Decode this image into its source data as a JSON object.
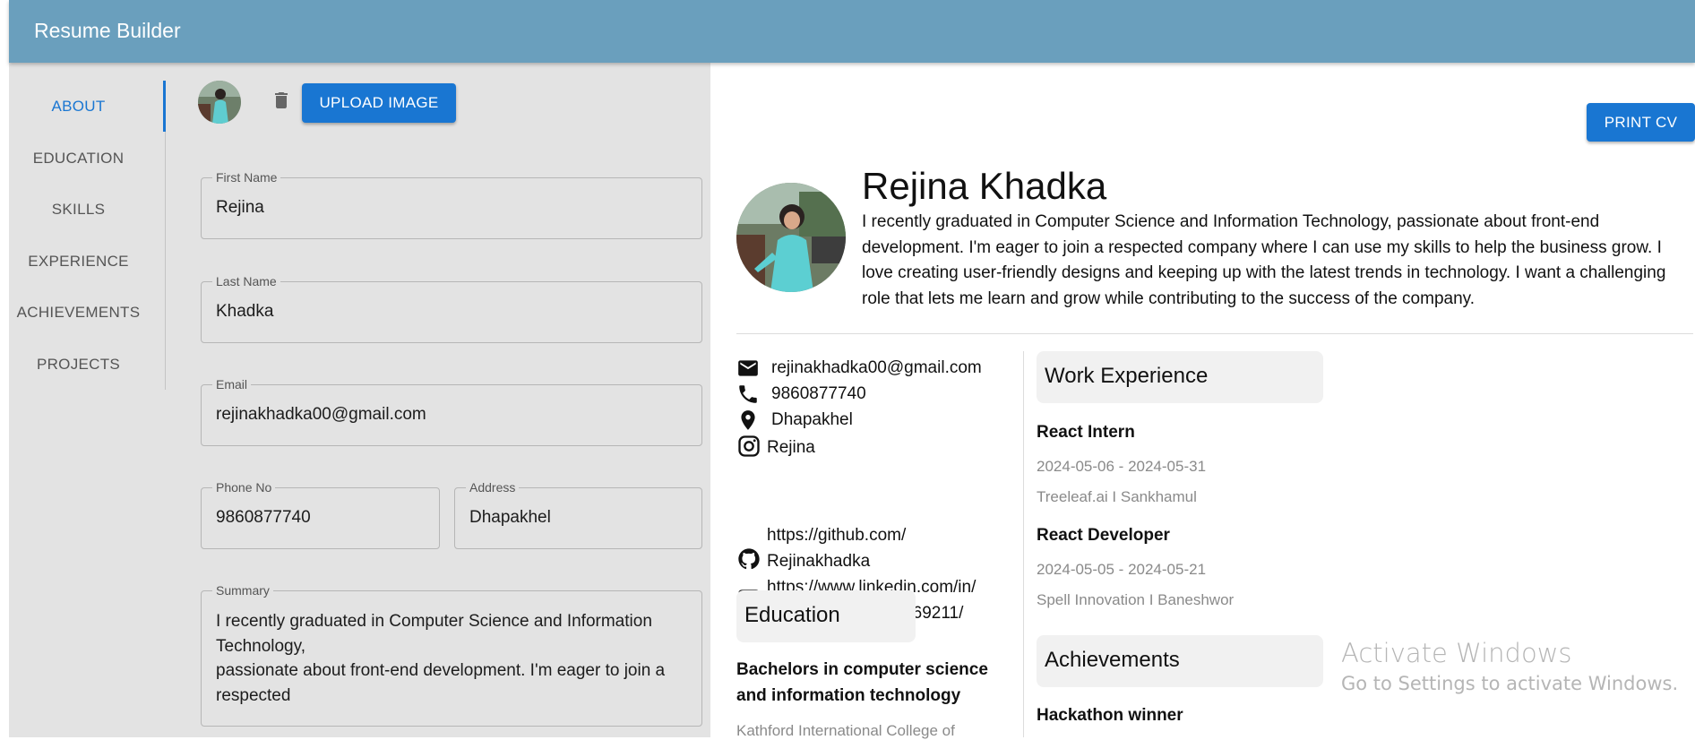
{
  "header": {
    "title": "Resume Builder"
  },
  "sidebar": {
    "tabs": [
      {
        "label": "ABOUT",
        "active": true
      },
      {
        "label": "EDUCATION",
        "active": false
      },
      {
        "label": "SKILLS",
        "active": false
      },
      {
        "label": "EXPERIENCE",
        "active": false
      },
      {
        "label": "ACHIEVEMENTS",
        "active": false
      },
      {
        "label": "PROJECTS",
        "active": false
      }
    ]
  },
  "about_form": {
    "upload_label": "UPLOAD IMAGE",
    "first_name": {
      "label": "First Name",
      "value": "Rejina"
    },
    "last_name": {
      "label": "Last Name",
      "value": "Khadka"
    },
    "email": {
      "label": "Email",
      "value": "rejinakhadka00@gmail.com"
    },
    "phone": {
      "label": "Phone No",
      "value": "9860877740"
    },
    "address": {
      "label": "Address",
      "value": "Dhapakhel"
    },
    "summary": {
      "label": "Summary",
      "value": "I recently graduated in Computer Science and Information Technology,\npassionate about front-end development. I'm eager to join a respected"
    }
  },
  "preview": {
    "print_label": "PRINT CV",
    "name": "Rejina Khadka",
    "summary": "I recently graduated in Computer Science and Information Technology, passionate about front-end development. I'm eager to join a respected company where I can use my skills to help the business grow. I love creating user-friendly designs and keeping up with the latest trends in technology. I want a challenging role that lets me learn and grow while contributing to the success of the company.",
    "contacts": {
      "email": "rejinakhadka00@gmail.com",
      "phone": "9860877740",
      "address": "Dhapakhel",
      "instagram": "Rejina",
      "github_line1": "https://github.com/",
      "github_line2": "Rejinakhadka",
      "linkedin_line1": "https://www.linkedin.com/in/",
      "linkedin_line2": "rejina-khadka-028969211/"
    },
    "education": {
      "title": "Education",
      "degree_line1": "Bachelors in computer science",
      "degree_line2": "and information technology",
      "school": "Kathford International College of"
    },
    "work_experience": {
      "title": "Work Experience",
      "items": [
        {
          "role": "React Intern",
          "dates": "2024-05-06 - 2024-05-31",
          "company": "Treeleaf.ai I Sankhamul"
        },
        {
          "role": "React Developer",
          "dates": "2024-05-05 - 2024-05-21",
          "company": "Spell Innovation I Baneshwor"
        }
      ]
    },
    "achievements": {
      "title": "Achievements",
      "items": [
        {
          "title": "Hackathon winner"
        }
      ]
    }
  },
  "os_watermark": {
    "title": "Activate Windows",
    "subtitle": "Go to Settings to activate Windows."
  },
  "colors": {
    "appbar": "#6a9fbd",
    "primary": "#1976d2",
    "editor_bg": "#e3e3e3",
    "section_bg": "#f1f1f1"
  }
}
